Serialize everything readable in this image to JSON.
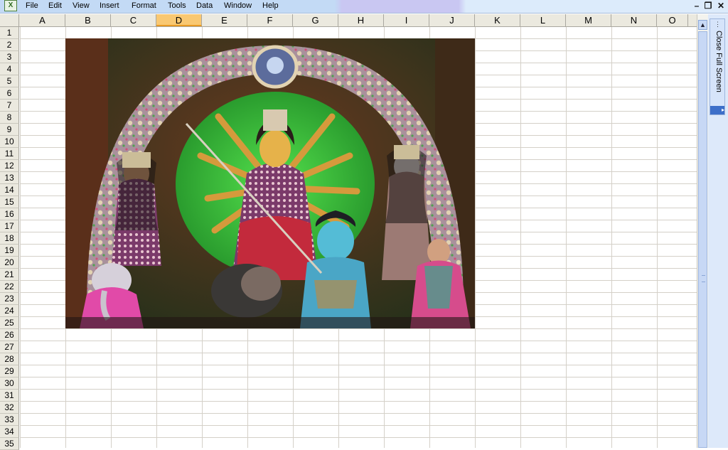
{
  "menubar": {
    "app_icon": "excel-icon",
    "items": [
      "File",
      "Edit",
      "View",
      "Insert",
      "Format",
      "Tools",
      "Data",
      "Window",
      "Help"
    ],
    "window_controls": {
      "minimize": "–",
      "restore": "❐",
      "close": "✕"
    }
  },
  "columns": [
    "A",
    "B",
    "C",
    "D",
    "E",
    "F",
    "G",
    "H",
    "I",
    "J",
    "K",
    "L",
    "M",
    "N",
    "O"
  ],
  "active_column": "D",
  "rows": [
    "1",
    "2",
    "3",
    "4",
    "5",
    "6",
    "7",
    "8",
    "9",
    "10",
    "11",
    "12",
    "13",
    "14",
    "15",
    "16",
    "17",
    "18",
    "19",
    "20",
    "21",
    "22",
    "23",
    "24",
    "25",
    "26",
    "27",
    "28",
    "29",
    "30",
    "31",
    "32",
    "33",
    "34",
    "35"
  ],
  "picture": {
    "description_icon": "durga-idol-picture"
  },
  "side_toolbar": {
    "close_full_screen": "Close Full Screen"
  },
  "colors": {
    "menubar": "#c3daf5",
    "header": "#ebe9df",
    "active_header": "#f9c872",
    "gridline": "#d4d0c8"
  }
}
